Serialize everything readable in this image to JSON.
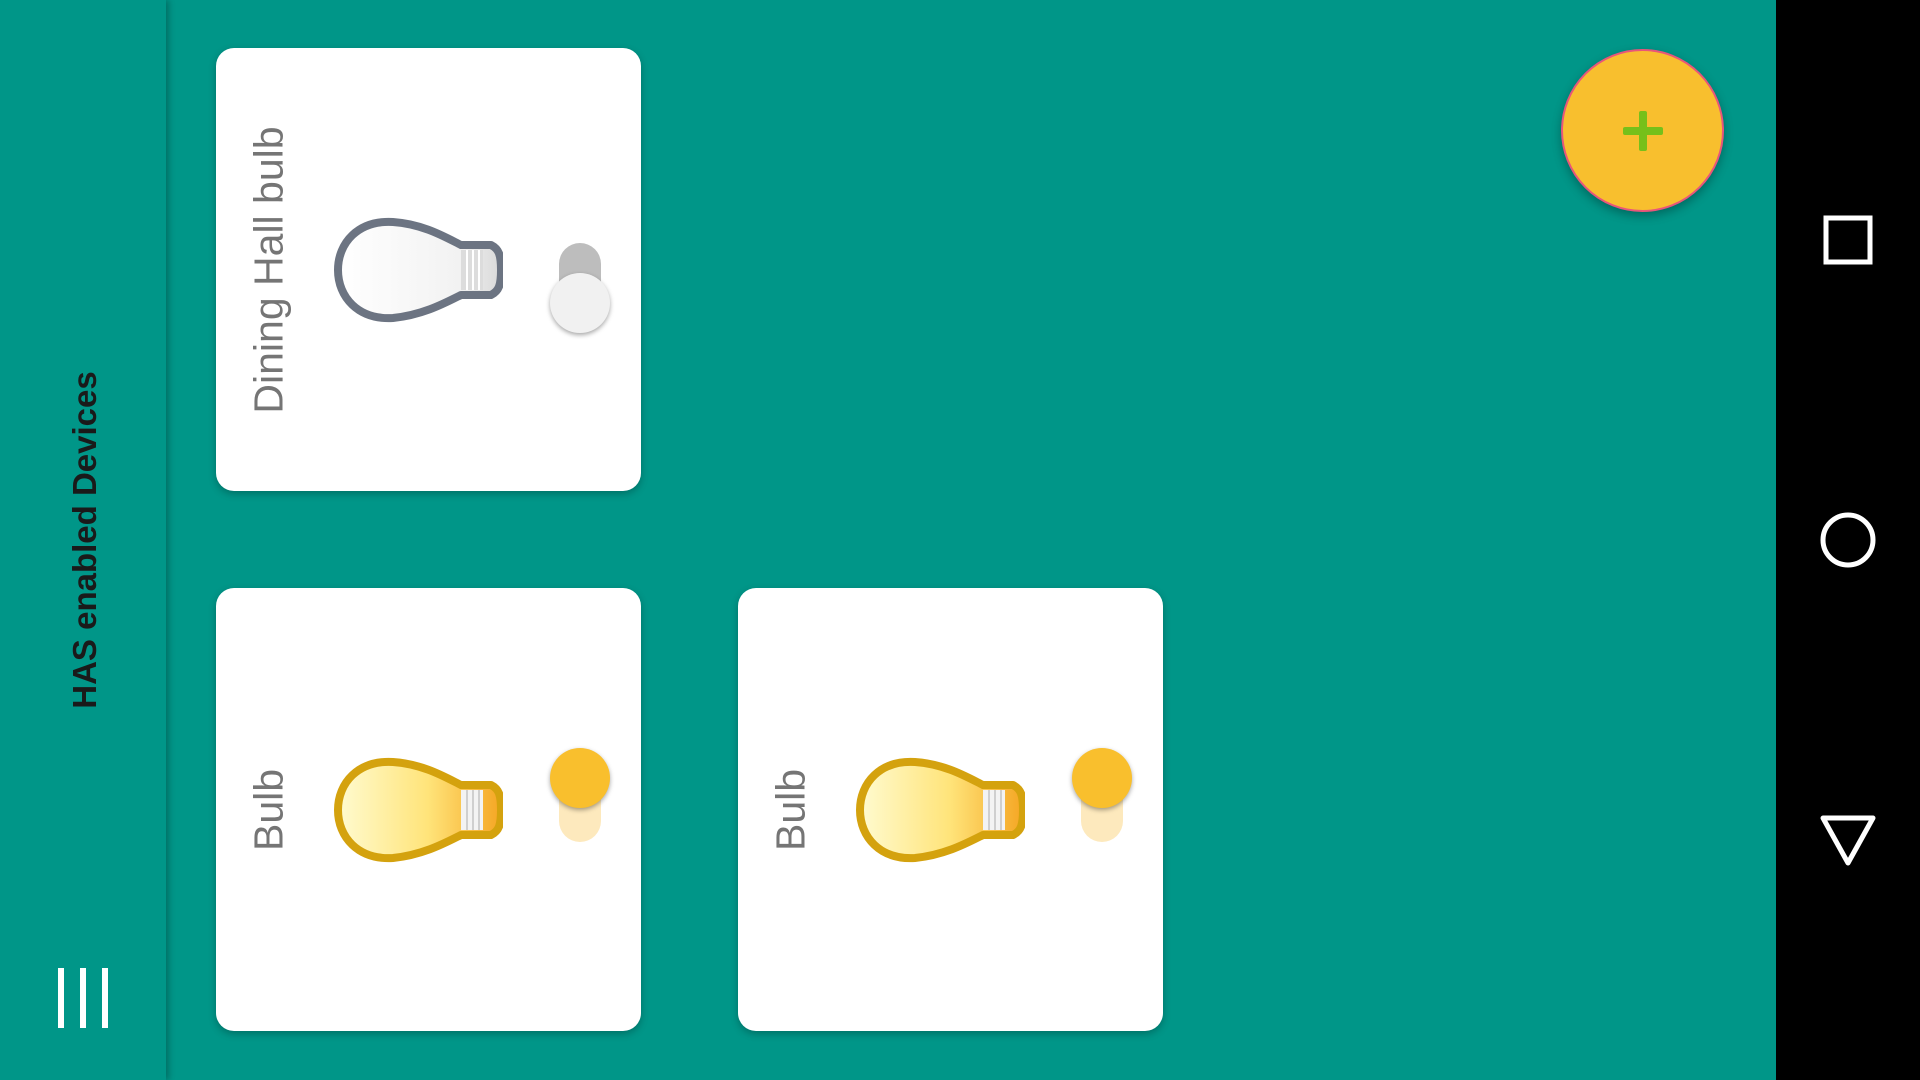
{
  "toolbar": {
    "title": "HAS enabled Devices",
    "menu_icon": "menu-icon"
  },
  "devices": [
    {
      "name": "Dining Hall bulb",
      "state": "off",
      "icon": "lightbulb-icon"
    },
    {
      "name": "Bulb",
      "state": "on",
      "icon": "lightbulb-icon"
    },
    {
      "name": "Bulb",
      "state": "on",
      "icon": "lightbulb-icon"
    }
  ],
  "fab": {
    "icon": "plus-icon"
  },
  "navbar": {
    "icons": [
      "recents-square-icon",
      "home-circle-icon",
      "back-triangle-icon"
    ]
  },
  "colors": {
    "background": "#009688",
    "card": "#ffffff",
    "accent": "#f9bf2d",
    "plus": "#76c01a",
    "bulb_off_outline": "#6c7482",
    "bulb_on_outline": "#d4a20e",
    "label": "#757575"
  }
}
